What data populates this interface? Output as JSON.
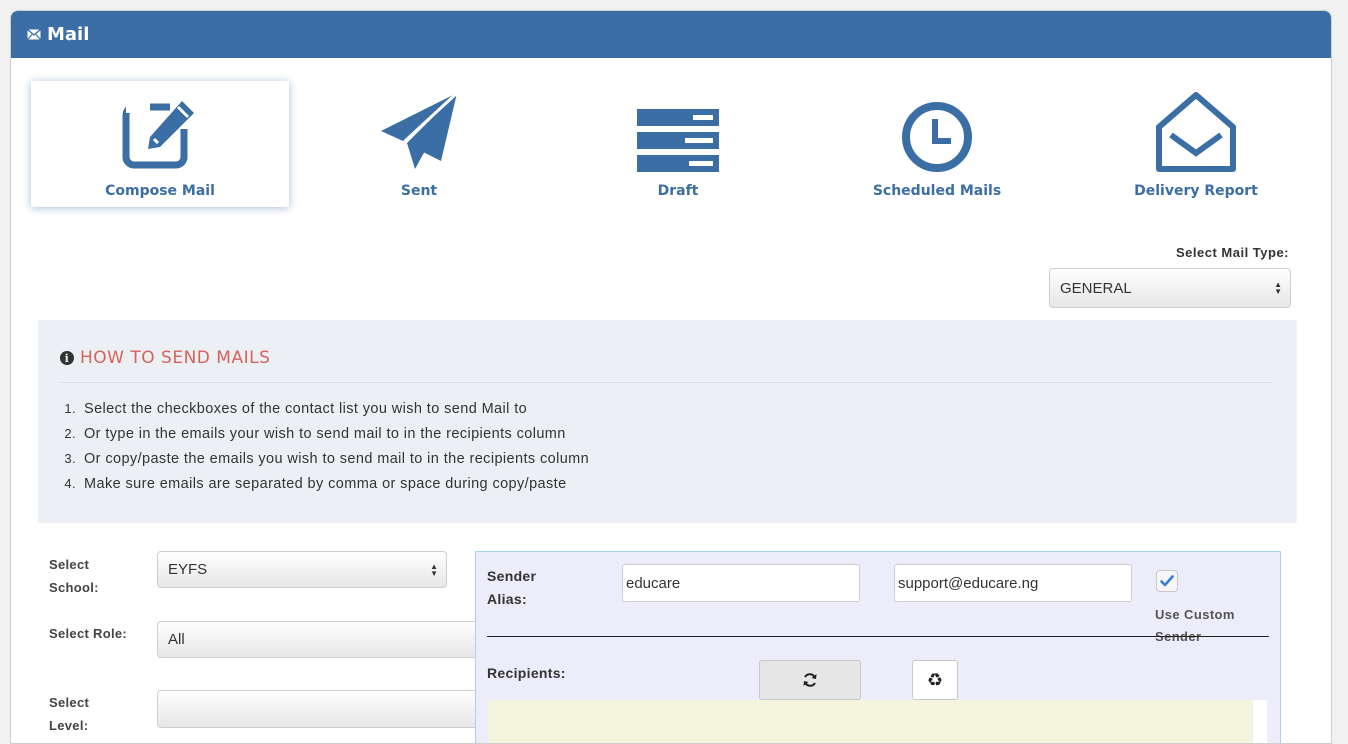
{
  "header": {
    "title": "Mail",
    "icon": "envelope-icon"
  },
  "nav": {
    "items": [
      {
        "label": "Compose Mail",
        "icon": "compose-icon",
        "active": true
      },
      {
        "label": "Sent",
        "icon": "paper-plane-icon",
        "active": false
      },
      {
        "label": "Draft",
        "icon": "draft-stack-icon",
        "active": false
      },
      {
        "label": "Scheduled Mails",
        "icon": "clock-icon",
        "active": false
      },
      {
        "label": "Delivery Report",
        "icon": "open-envelope-icon",
        "active": false
      }
    ]
  },
  "mail_type": {
    "label": "Select Mail Type:",
    "value": "GENERAL"
  },
  "instructions": {
    "title": "HOW TO SEND MAILS",
    "steps": [
      {
        "num": "1.",
        "text": "Select the checkboxes of the contact list you wish to send Mail to"
      },
      {
        "num": "2.",
        "text": "Or type in the emails your wish to send mail to in the recipients column"
      },
      {
        "num": "3.",
        "text": "Or copy/paste the emails you wish to send mail to in the recipients column"
      },
      {
        "num": "4.",
        "text": "Make sure emails are separated by comma or space during copy/paste"
      }
    ]
  },
  "filters": {
    "school": {
      "label": "Select School:",
      "value": "EYFS"
    },
    "role": {
      "label": "Select Role:",
      "value": "All"
    },
    "level": {
      "label": "Select Level:",
      "value": ""
    }
  },
  "sender": {
    "alias_label": "Sender Alias:",
    "alias_value": "educare",
    "email_value": "support@educare.ng",
    "custom_checked": true,
    "custom_label": "Use Custom Sender",
    "recipients_label": "Recipients:",
    "recycle_glyph": "♻"
  },
  "colors": {
    "brand": "#3b6ea5",
    "instruction_title": "#d5635a",
    "info_bg": "#eceff4",
    "sender_bg": "#ececfb",
    "recipients_bg": "#f5f4dc"
  }
}
